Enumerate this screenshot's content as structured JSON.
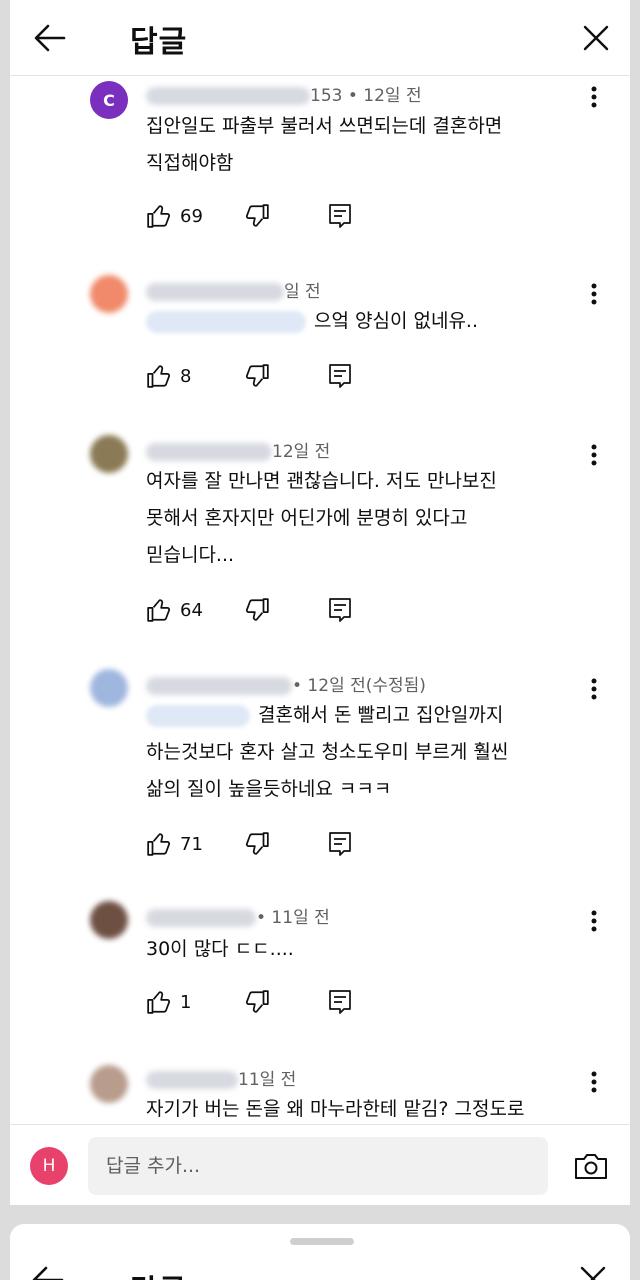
{
  "header": {
    "title": "답글"
  },
  "comments": [
    {
      "meta": "153 • 12일 전",
      "avatar_letter": "C",
      "avatar_color": "#7b2fbf",
      "text_lines": [
        "집안일도 파출부 불러서 쓰면되는데 결혼하면",
        "직접해야함"
      ],
      "likes": "69"
    },
    {
      "meta": "일 전",
      "avatar_letter": "",
      "avatar_color": "#f08a6a",
      "text_lines": [
        "으엌 양심이 없네유.."
      ],
      "likes": "8"
    },
    {
      "meta": "12일 전",
      "avatar_letter": "",
      "avatar_color": "#8a7a55",
      "text_lines": [
        "여자를 잘 만나면 괜찮습니다. 저도 만나보진",
        "못해서 혼자지만 어딘가에 분명히 있다고",
        "믿습니다..."
      ],
      "likes": "64"
    },
    {
      "meta": "• 12일 전(수정됨)",
      "avatar_letter": "",
      "avatar_color": "#9fb6df",
      "text_lines": [
        "결혼해서 돈 빨리고 집안일까지",
        "하는것보다 혼자 살고 청소도우미 부르게 훨씬",
        "삶의 질이 높을듯하네요 ㅋㅋㅋ"
      ],
      "likes": "71"
    },
    {
      "meta": "• 11일 전",
      "avatar_letter": "",
      "avatar_color": "#6e5043",
      "text_lines": [
        "30이 많다 ㄷㄷ...."
      ],
      "likes": "1"
    },
    {
      "meta": "11일 전",
      "avatar_letter": "",
      "avatar_color": "#b89c8c",
      "text_lines": [
        "자기가 버는 돈을 왜 마누라한테 맡김? 그정도로"
      ],
      "likes": ""
    }
  ],
  "composer": {
    "user_initial": "H",
    "placeholder": "답글 추가..."
  },
  "sheet2": {
    "title": "답글"
  },
  "colors": {
    "user_avatar": "#e8416c",
    "text": "#0f0f0f",
    "meta": "#606060"
  }
}
